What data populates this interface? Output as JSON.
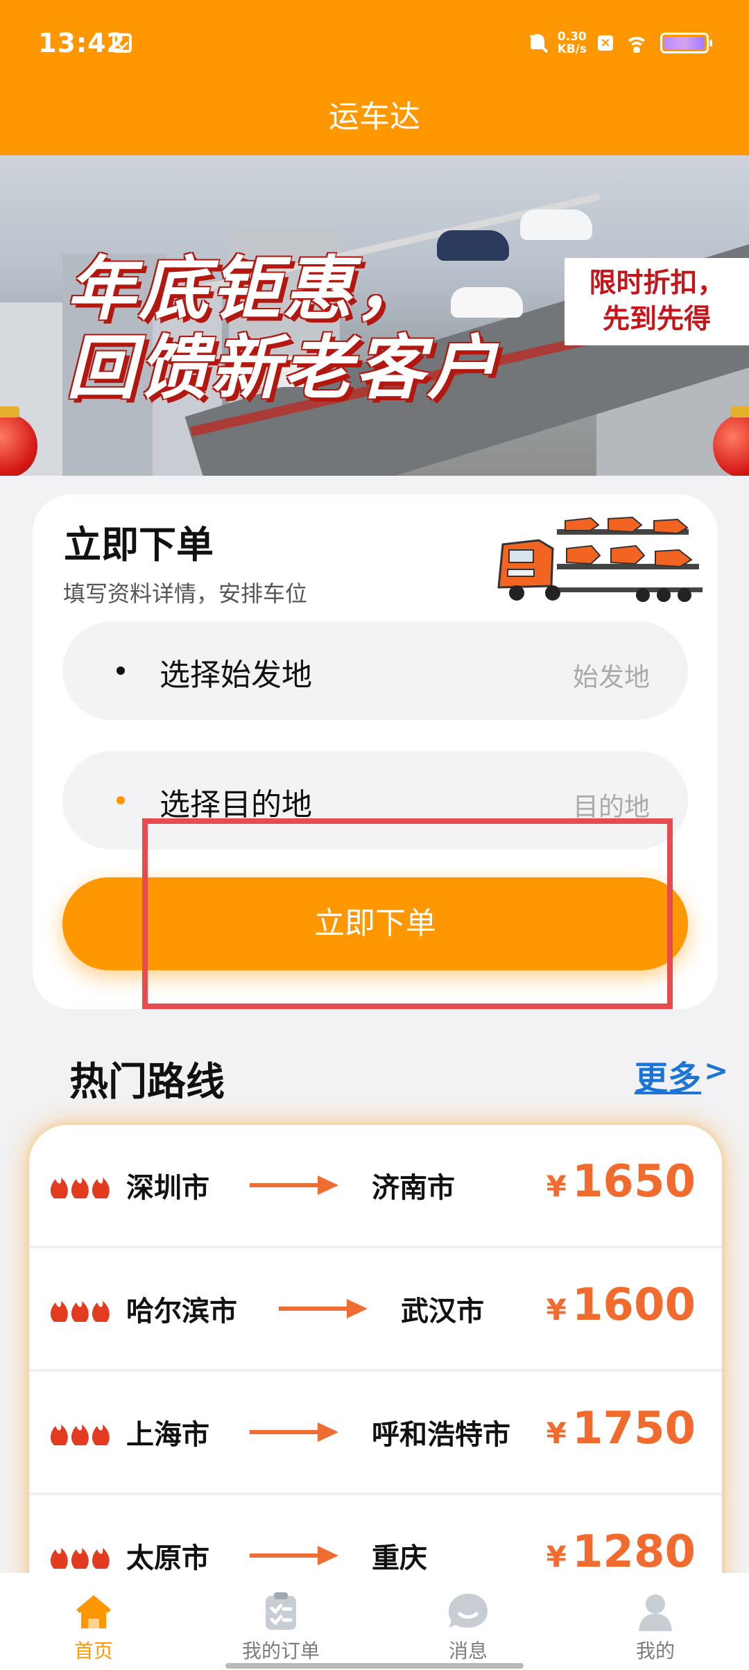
{
  "status_bar": {
    "time": "13:42",
    "network_speed": "0.30",
    "network_unit": "KB/s"
  },
  "app": {
    "title": "运车达"
  },
  "banner": {
    "headline_line1": "年底钜惠，",
    "headline_line2": "回馈新老客户",
    "badge_line1": "限时折扣，",
    "badge_line2": "先到先得"
  },
  "order_card": {
    "title": "立即下单",
    "subtitle": "填写资料详情，安排车位",
    "origin_label": "选择始发地",
    "origin_placeholder": "始发地",
    "destination_label": "选择目的地",
    "destination_placeholder": "目的地",
    "submit_label": "立即下单"
  },
  "hot_routes": {
    "title": "热门路线",
    "more_label": "更多",
    "more_arrow": ">",
    "currency": "¥",
    "items": [
      {
        "from": "深圳市",
        "to": "济南市",
        "price": "1650"
      },
      {
        "from": "哈尔滨市",
        "to": "武汉市",
        "price": "1600"
      },
      {
        "from": "上海市",
        "to": "呼和浩特市",
        "price": "1750"
      },
      {
        "from": "太原市",
        "to": "重庆",
        "price": "1280"
      }
    ]
  },
  "bottom_nav": {
    "items": [
      {
        "label": "首页",
        "icon": "home-icon",
        "active": true
      },
      {
        "label": "我的订单",
        "icon": "orders-icon",
        "active": false
      },
      {
        "label": "消息",
        "icon": "message-icon",
        "active": false
      },
      {
        "label": "我的",
        "icon": "profile-icon",
        "active": false
      }
    ]
  },
  "colors": {
    "brand_orange": "#ff9700",
    "price_orange": "#f26b2e",
    "link_blue": "#1c75d6",
    "highlight_red": "#e74b50"
  }
}
